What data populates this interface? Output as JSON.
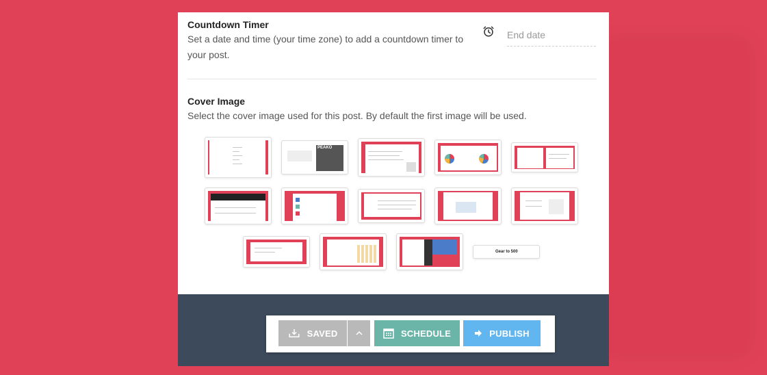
{
  "countdown": {
    "title": "Countdown Timer",
    "description": "Set a date and time (your time zone) to add a countdown timer to your post.",
    "end_date_placeholder": "End date"
  },
  "cover": {
    "title": "Cover Image",
    "description": "Select the cover image used for this post. By default the first image will be used.",
    "thumbnail_texts": {
      "t2_caption": "PEAKO",
      "t14_caption": "Gear to 500"
    }
  },
  "footer": {
    "saved_label": "SAVED",
    "schedule_label": "SCHEDULE",
    "publish_label": "PUBLISH"
  },
  "colors": {
    "background": "#e14157",
    "footer": "#3d4a5c",
    "saved": "#b9b9b9",
    "schedule": "#6bb5a8",
    "publish": "#62b6ef"
  },
  "icons": {
    "clock": "alarm-clock-icon",
    "saved": "cloud-download-icon",
    "arrow": "chevron-up-icon",
    "schedule": "calendar-icon",
    "publish": "arrow-right-icon"
  }
}
